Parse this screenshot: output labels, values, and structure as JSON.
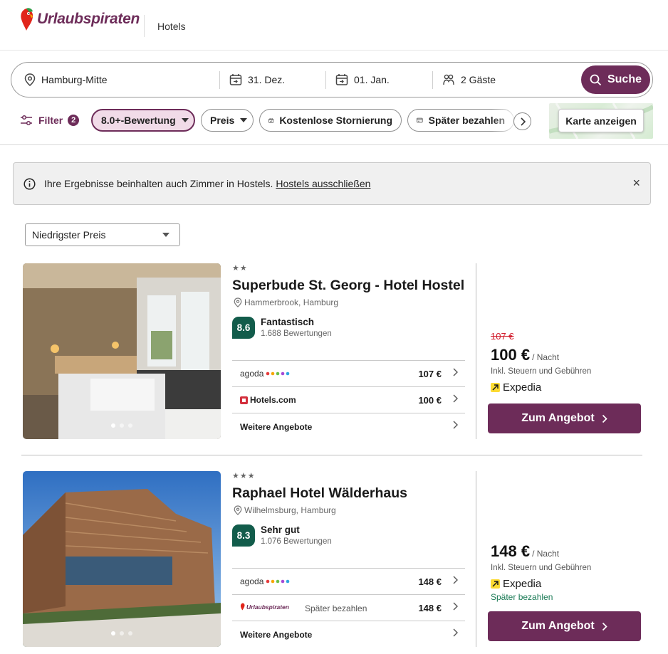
{
  "header": {
    "brand": "Urlaubspiraten",
    "nav": "Hotels"
  },
  "search": {
    "destination": "Hamburg-Mitte",
    "checkin": "31. Dez.",
    "checkout": "01. Jan.",
    "guests": "2 Gäste",
    "button": "Suche"
  },
  "filters": {
    "filter_label": "Filter",
    "filter_count": "2",
    "chips": [
      "8.0+-Bewertung",
      "Preis",
      "Kostenlose Stornierung",
      "Später bezahlen"
    ],
    "map_button": "Karte anzeigen"
  },
  "banner": {
    "text": "Ihre Ergebnisse beinhalten auch Zimmer in Hostels.",
    "link": "Hostels ausschließen",
    "close": "×"
  },
  "sort": {
    "value": "Niedrigster Preis"
  },
  "hotels": [
    {
      "stars": "★★",
      "name": "Superbude St. Georg - Hotel Hostel",
      "location": "Hammerbrook, Hamburg",
      "score": "8.6",
      "rating_word": "Fantastisch",
      "reviews": "1.688 Bewertungen",
      "offers": [
        {
          "provider": "agoda",
          "note": "",
          "price": "107 €"
        },
        {
          "provider": "Hotels.com",
          "note": "",
          "price": "100 €"
        }
      ],
      "more_offers": "Weitere Angebote",
      "old_price": "107 €",
      "price": "100 €",
      "per_night": "/ Nacht",
      "incl": "Inkl. Steuern und Gebühren",
      "partner": "Expedia",
      "later": "",
      "cta": "Zum Angebot"
    },
    {
      "stars": "★★★",
      "name": "Raphael Hotel Wälderhaus",
      "location": "Wilhelmsburg, Hamburg",
      "score": "8.3",
      "rating_word": "Sehr gut",
      "reviews": "1.076 Bewertungen",
      "offers": [
        {
          "provider": "agoda",
          "note": "",
          "price": "148 €"
        },
        {
          "provider": "Urlaubspiraten",
          "note": "Später bezahlen",
          "price": "148 €"
        }
      ],
      "more_offers": "Weitere Angebote",
      "old_price": "",
      "price": "148 €",
      "per_night": "/ Nacht",
      "incl": "Inkl. Steuern und Gebühren",
      "partner": "Expedia",
      "later": "Später bezahlen",
      "cta": "Zum Angebot"
    }
  ],
  "colors": {
    "brand": "#6d2c59",
    "rating": "#125c4b",
    "strike": "#d11a2a",
    "later": "#1a7a55"
  }
}
